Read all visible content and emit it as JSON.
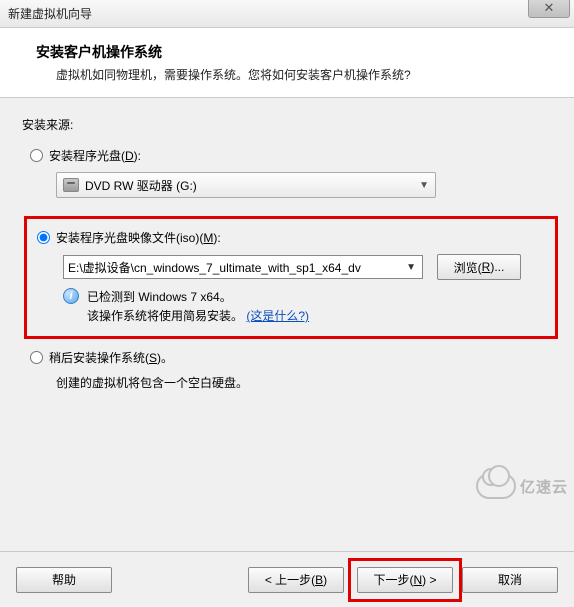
{
  "window": {
    "title": "新建虚拟机向导",
    "close_glyph": "✕"
  },
  "header": {
    "heading": "安装客户机操作系统",
    "subtitle": "虚拟机如同物理机，需要操作系统。您将如何安装客户机操作系统?"
  },
  "body": {
    "source_label": "安装来源:",
    "opt_disc": {
      "label_pre": "安装程序光盘(",
      "accel": "D",
      "label_post": "):",
      "drive_text": "DVD RW 驱动器 (G:)"
    },
    "opt_iso": {
      "label_pre": "安装程序光盘映像文件(iso)(",
      "accel": "M",
      "label_post": "):",
      "path": "E:\\虚拟设备\\cn_windows_7_ultimate_with_sp1_x64_dv",
      "browse_pre": "浏览(",
      "browse_accel": "R",
      "browse_post": ")...",
      "info_line1": "已检测到 Windows 7 x64。",
      "info_line2_pre": "该操作系统将使用简易安装。",
      "info_link": "(这是什么?)"
    },
    "opt_later": {
      "label_pre": "稍后安装操作系统(",
      "accel": "S",
      "label_post": ")。",
      "desc": "创建的虚拟机将包含一个空白硬盘。"
    }
  },
  "footer": {
    "help": "帮助",
    "back_pre": "< 上一步(",
    "back_accel": "B",
    "back_post": ")",
    "next_pre": "下一步(",
    "next_accel": "N",
    "next_post": ") >",
    "cancel": "取消"
  },
  "watermark": "亿速云",
  "colors": {
    "highlight": "#e10000",
    "link": "#0a4fbf"
  }
}
